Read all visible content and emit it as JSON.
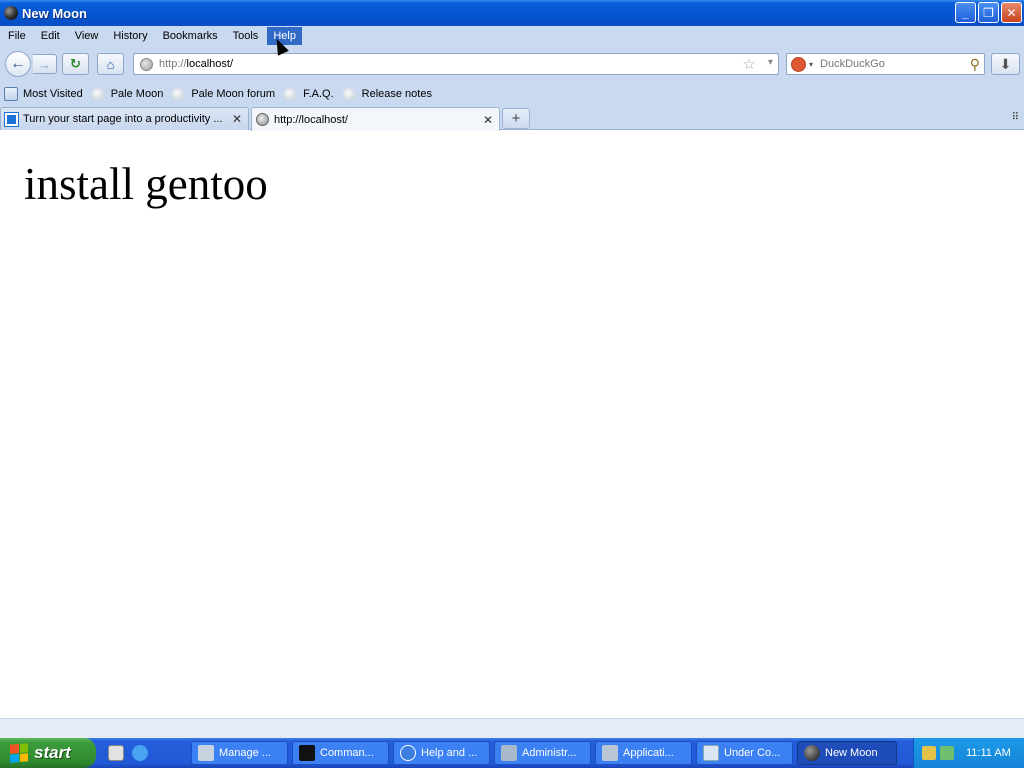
{
  "window": {
    "title": "New Moon",
    "minimize": "_",
    "maximize": "❐",
    "close": "✕"
  },
  "menu": {
    "items": [
      "File",
      "Edit",
      "View",
      "History",
      "Bookmarks",
      "Tools",
      "Help"
    ]
  },
  "nav": {
    "url_proto": "http://",
    "url_host": "localhost/",
    "search_placeholder": "DuckDuckGo",
    "icons": {
      "back": "←",
      "forward": "→",
      "reload": "↻",
      "home": "⌂",
      "star": "☆",
      "drop": "▾",
      "magnifier": "⚲",
      "download": "⬇"
    }
  },
  "bookmarks": [
    "Most Visited",
    "Pale Moon",
    "Pale Moon forum",
    "F.A.Q.",
    "Release notes"
  ],
  "tabs": [
    {
      "label": "Turn your start page into a productivity ...",
      "close": "✕"
    },
    {
      "label": "http://localhost/",
      "close": "✕"
    }
  ],
  "newtab": "+",
  "tablist": "⠿",
  "content": {
    "heading": "install gentoo"
  },
  "taskbar": {
    "start": "start",
    "buttons": [
      "Manage ...",
      "Comman...",
      "Help and ...",
      "Administr...",
      "Applicati...",
      "Under Co...",
      "New Moon"
    ],
    "clock": "11:11 AM"
  },
  "colors": {
    "titlebar": "#0554d0",
    "taskbar": "#245edb",
    "start": "#3c9c3c",
    "chrome": "#c9daf0",
    "menu_active": "#3169c6"
  }
}
